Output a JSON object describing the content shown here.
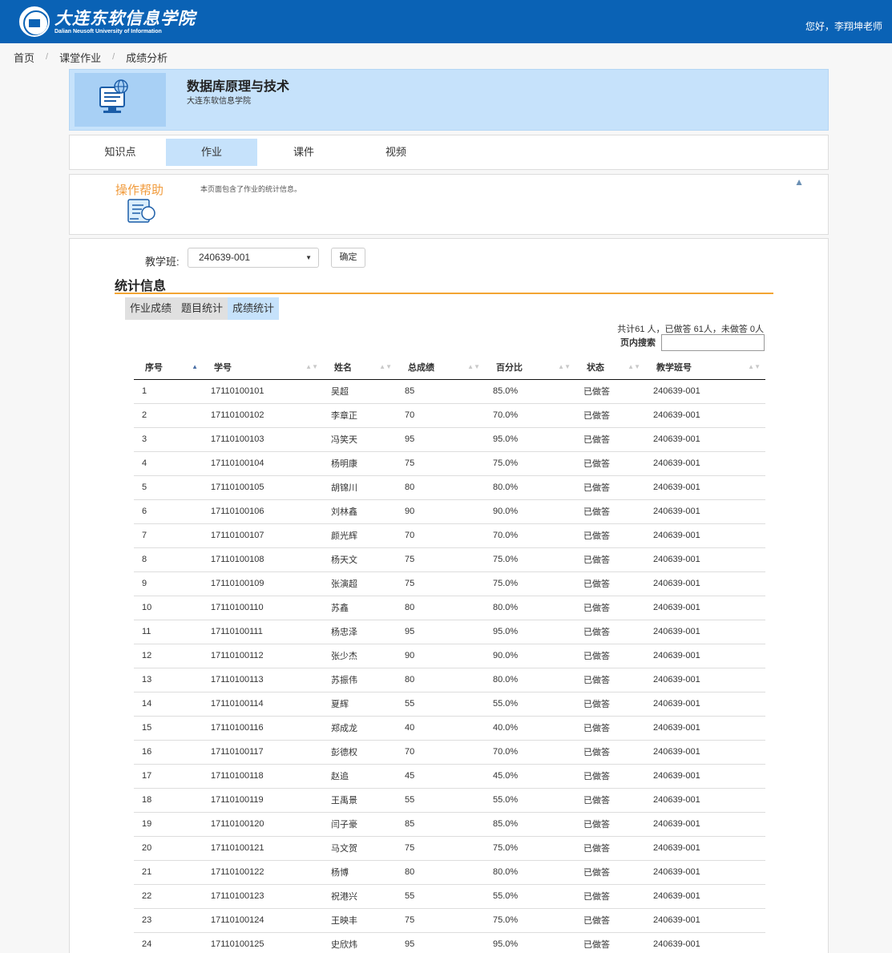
{
  "header": {
    "logo_cn": "大连东软信息学院",
    "logo_en": "Dalian Neusoft University of Information",
    "greeting": "您好，李翔坤老师"
  },
  "breadcrumb": [
    "首页",
    "课堂作业",
    "成绩分析"
  ],
  "course": {
    "title": "数据库原理与技术",
    "subtitle": "大连东软信息学院"
  },
  "tabs": [
    {
      "label": "知识点",
      "active": false
    },
    {
      "label": "作业",
      "active": true
    },
    {
      "label": "课件",
      "active": false
    },
    {
      "label": "视频",
      "active": false
    }
  ],
  "help": {
    "title": "操作帮助",
    "text": "本页面包含了作业的统计信息。"
  },
  "filter": {
    "class_label": "教学班:",
    "class_value": "240639-001",
    "confirm_label": "确定"
  },
  "stats": {
    "title": "统计信息",
    "subtabs": [
      {
        "label": "作业成绩",
        "active": false
      },
      {
        "label": "题目统计",
        "active": false
      },
      {
        "label": "成绩统计",
        "active": true
      }
    ],
    "summary": "共计61 人，已做答 61人，未做答 0人",
    "search_label": "页内搜索"
  },
  "table": {
    "columns": [
      "序号",
      "学号",
      "姓名",
      "总成绩",
      "百分比",
      "状态",
      "教学班号"
    ],
    "rows": [
      [
        "1",
        "17110100101",
        "吴超",
        "85",
        "85.0%",
        "已做答",
        "240639-001"
      ],
      [
        "2",
        "17110100102",
        "李章正",
        "70",
        "70.0%",
        "已做答",
        "240639-001"
      ],
      [
        "3",
        "17110100103",
        "冯笑天",
        "95",
        "95.0%",
        "已做答",
        "240639-001"
      ],
      [
        "4",
        "17110100104",
        "杨明康",
        "75",
        "75.0%",
        "已做答",
        "240639-001"
      ],
      [
        "5",
        "17110100105",
        "胡锦川",
        "80",
        "80.0%",
        "已做答",
        "240639-001"
      ],
      [
        "6",
        "17110100106",
        "刘林鑫",
        "90",
        "90.0%",
        "已做答",
        "240639-001"
      ],
      [
        "7",
        "17110100107",
        "颜光辉",
        "70",
        "70.0%",
        "已做答",
        "240639-001"
      ],
      [
        "8",
        "17110100108",
        "杨天文",
        "75",
        "75.0%",
        "已做答",
        "240639-001"
      ],
      [
        "9",
        "17110100109",
        "张演超",
        "75",
        "75.0%",
        "已做答",
        "240639-001"
      ],
      [
        "10",
        "17110100110",
        "苏鑫",
        "80",
        "80.0%",
        "已做答",
        "240639-001"
      ],
      [
        "11",
        "17110100111",
        "杨忠泽",
        "95",
        "95.0%",
        "已做答",
        "240639-001"
      ],
      [
        "12",
        "17110100112",
        "张少杰",
        "90",
        "90.0%",
        "已做答",
        "240639-001"
      ],
      [
        "13",
        "17110100113",
        "苏振伟",
        "80",
        "80.0%",
        "已做答",
        "240639-001"
      ],
      [
        "14",
        "17110100114",
        "夏辉",
        "55",
        "55.0%",
        "已做答",
        "240639-001"
      ],
      [
        "15",
        "17110100116",
        "郑成龙",
        "40",
        "40.0%",
        "已做答",
        "240639-001"
      ],
      [
        "16",
        "17110100117",
        "彭德权",
        "70",
        "70.0%",
        "已做答",
        "240639-001"
      ],
      [
        "17",
        "17110100118",
        "赵追",
        "45",
        "45.0%",
        "已做答",
        "240639-001"
      ],
      [
        "18",
        "17110100119",
        "王禹景",
        "55",
        "55.0%",
        "已做答",
        "240639-001"
      ],
      [
        "19",
        "17110100120",
        "闫子豪",
        "85",
        "85.0%",
        "已做答",
        "240639-001"
      ],
      [
        "20",
        "17110100121",
        "马文贺",
        "75",
        "75.0%",
        "已做答",
        "240639-001"
      ],
      [
        "21",
        "17110100122",
        "杨博",
        "80",
        "80.0%",
        "已做答",
        "240639-001"
      ],
      [
        "22",
        "17110100123",
        "祝港兴",
        "55",
        "55.0%",
        "已做答",
        "240639-001"
      ],
      [
        "23",
        "17110100124",
        "王映丰",
        "75",
        "75.0%",
        "已做答",
        "240639-001"
      ],
      [
        "24",
        "17110100125",
        "史欣炜",
        "95",
        "95.0%",
        "已做答",
        "240639-001"
      ]
    ]
  },
  "colors": {
    "header_bg": "#0a62b5",
    "active_tab_bg": "#c6e2fb",
    "help_title": "#f19b3c",
    "section_line": "#f3a533"
  }
}
